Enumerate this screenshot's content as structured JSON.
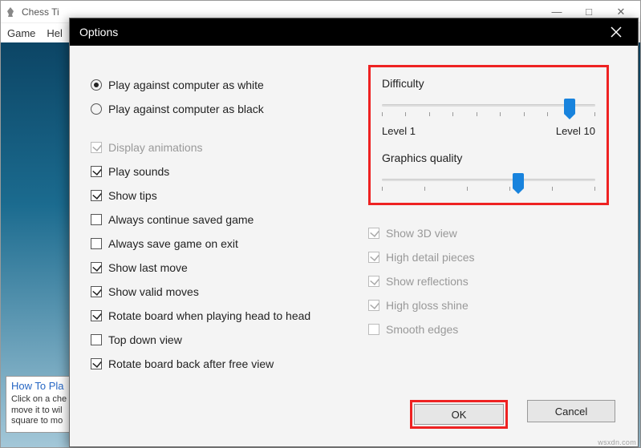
{
  "mainWindow": {
    "title": "Chess Ti",
    "menu": {
      "game": "Game",
      "help": "Hel"
    },
    "controls": {
      "min": "—",
      "max": "□",
      "close": "✕"
    },
    "tooltip": {
      "title": "How To Pla",
      "line1": "Click on a che",
      "line2": "move it to wil",
      "line3": "square to mo"
    }
  },
  "dialog": {
    "title": "Options",
    "radios": {
      "white": "Play against computer as white",
      "black": "Play against computer as black"
    },
    "checks": {
      "animations": "Display animations",
      "sounds": "Play sounds",
      "tips": "Show tips",
      "continueSaved": "Always continue saved game",
      "saveExit": "Always save game on exit",
      "lastMove": "Show last move",
      "validMoves": "Show valid moves",
      "rotateHead": "Rotate board when playing head to head",
      "topDown": "Top down view",
      "rotateBack": "Rotate board back after free view"
    },
    "difficulty": {
      "label": "Difficulty",
      "min": "Level 1",
      "max": "Level 10"
    },
    "graphics": {
      "label": "Graphics quality",
      "show3d": "Show 3D view",
      "highDetail": "High detail pieces",
      "reflections": "Show reflections",
      "gloss": "High gloss shine",
      "smooth": "Smooth edges"
    },
    "buttons": {
      "ok": "OK",
      "cancel": "Cancel"
    }
  },
  "watermark": "wsxdn.com"
}
